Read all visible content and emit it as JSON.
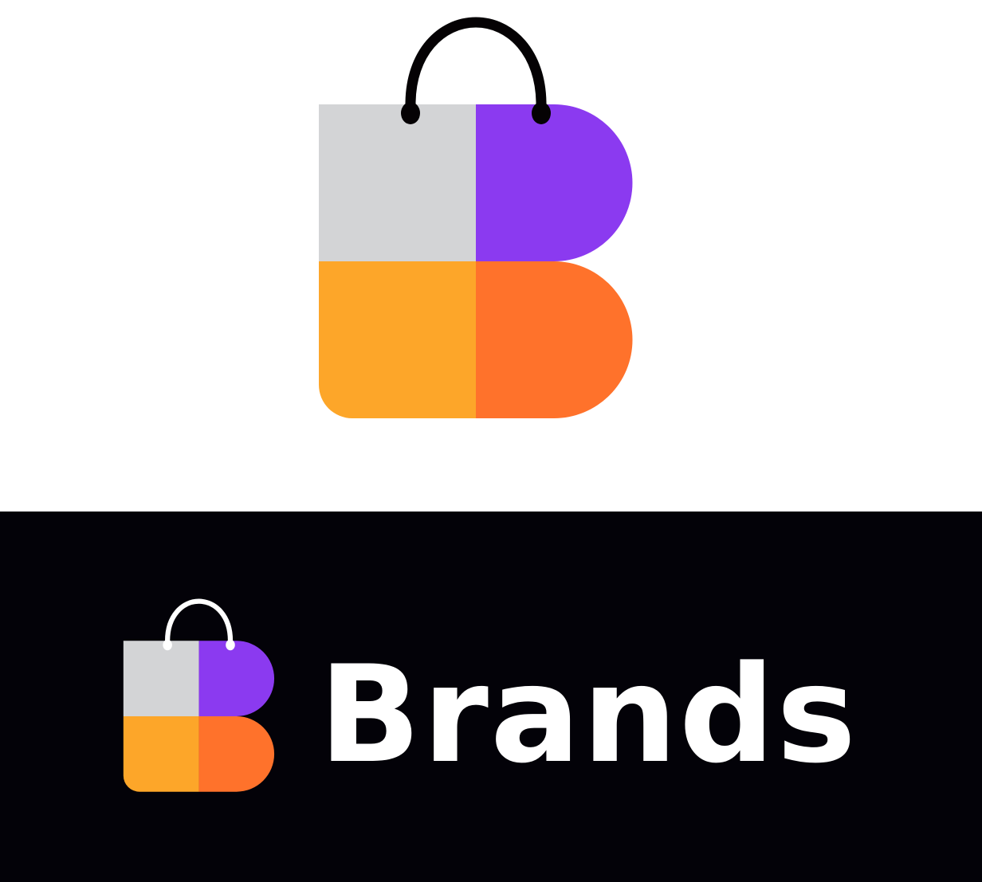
{
  "brand": {
    "name": "Brands"
  },
  "colors": {
    "gray": "#d3d4d6",
    "purple": "#8b3af0",
    "yellow": "#fda629",
    "orange": "#ff722b",
    "handle_light_bg": "#050204",
    "handle_dark_bg": "#ffffff",
    "dark_background": "#030208",
    "light_background": "#ffffff"
  },
  "icons": {
    "primary": "shopping-bag-b-icon",
    "secondary": "shopping-bag-b-icon"
  }
}
